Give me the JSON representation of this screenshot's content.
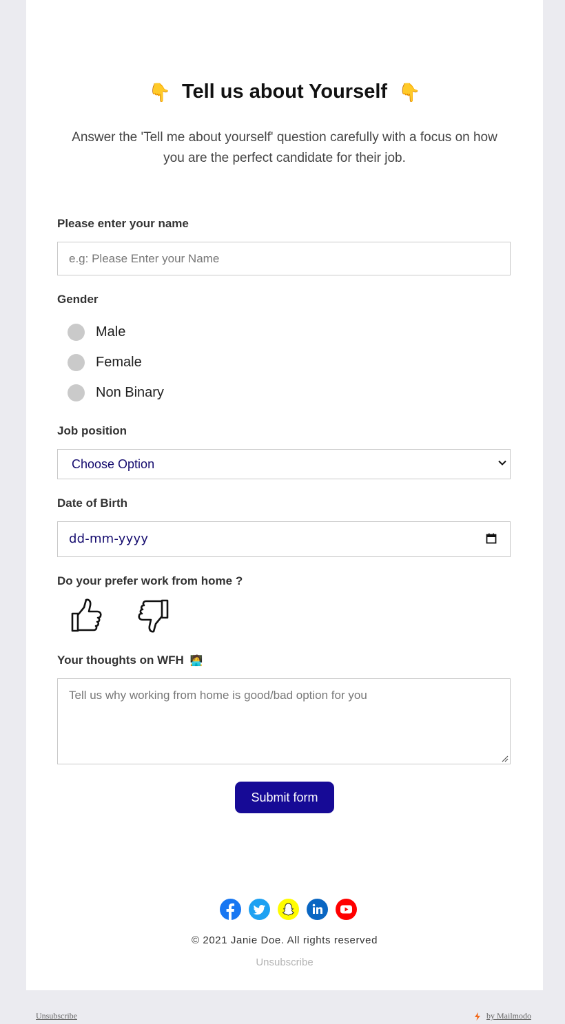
{
  "header": {
    "emoji_left": "👇",
    "title": "Tell us about Yourself",
    "emoji_right": "👇",
    "subtitle": "Answer the 'Tell me about yourself' question carefully with a focus on how you are the perfect candidate for their job."
  },
  "name_field": {
    "label": "Please enter your name",
    "placeholder": "e.g: Please Enter your Name",
    "value": ""
  },
  "gender": {
    "label": "Gender",
    "options": [
      "Male",
      "Female",
      "Non Binary"
    ]
  },
  "job_position": {
    "label": "Job position",
    "selected": "Choose Option"
  },
  "dob": {
    "label": "Date of Birth",
    "placeholder": "dd-mm-yyyy"
  },
  "wfh_pref": {
    "label": "Do your prefer work from home ?",
    "icons": [
      "thumbs-up-icon",
      "thumbs-down-icon"
    ]
  },
  "thoughts": {
    "label": "Your thoughts on WFH",
    "emoji": "🧑‍💻",
    "placeholder": "Tell us why working  from home is good/bad option for you"
  },
  "submit_label": "Submit form",
  "socials": [
    {
      "name": "facebook-icon",
      "color": "#1877f2"
    },
    {
      "name": "twitter-icon",
      "color": "#1da1f2"
    },
    {
      "name": "snapchat-icon",
      "color": "#fffc00"
    },
    {
      "name": "linkedin-icon",
      "color": "#0a66c2"
    },
    {
      "name": "youtube-icon",
      "color": "#ff0000"
    }
  ],
  "footer": {
    "copyright": "© 2021 Janie Doe. All rights reserved",
    "unsubscribe_inner": "Unsubscribe",
    "unsubscribe_outer": "Unsubscribe",
    "by_mailmodo": "by Mailmodo"
  },
  "colors": {
    "accent": "#160a96",
    "page_bg": "#ebebf0",
    "select_text": "#140b6e"
  }
}
